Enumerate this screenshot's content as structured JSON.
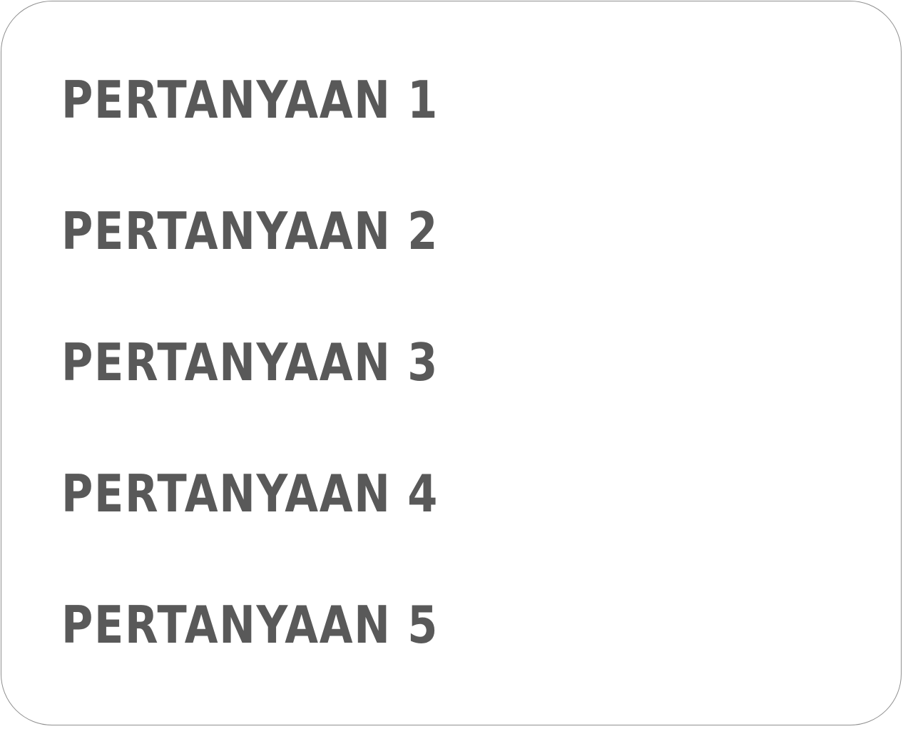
{
  "colors": {
    "text": "#595959",
    "border": "#8f8f8f",
    "background": "#ffffff"
  },
  "questions": [
    {
      "label": "PERTANYAAN 1"
    },
    {
      "label": "PERTANYAAN 2"
    },
    {
      "label": "PERTANYAAN 3"
    },
    {
      "label": "PERTANYAAN 4"
    },
    {
      "label": "PERTANYAAN 5"
    }
  ]
}
